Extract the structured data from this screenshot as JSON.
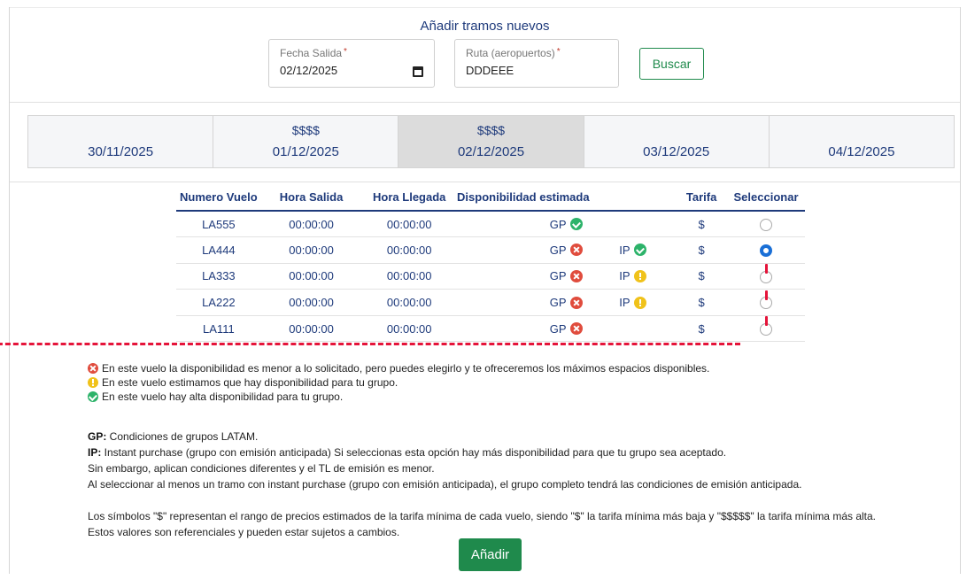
{
  "header": {
    "title": "Añadir tramos nuevos"
  },
  "form": {
    "fecha_label": "Fecha Salida",
    "fecha_value": "02/12/2025",
    "ruta_label": "Ruta (aeropuertos)",
    "ruta_value": "DDDEEE",
    "required_mark": "*",
    "buscar_label": "Buscar"
  },
  "dates": [
    {
      "price": "",
      "date": "30/11/2025",
      "active": false
    },
    {
      "price": "$$$$",
      "date": "01/12/2025",
      "active": false
    },
    {
      "price": "$$$$",
      "date": "02/12/2025",
      "active": true
    },
    {
      "price": "",
      "date": "03/12/2025",
      "active": false
    },
    {
      "price": "",
      "date": "04/12/2025",
      "active": false
    }
  ],
  "table": {
    "headers": [
      "Numero Vuelo",
      "Hora Salida",
      "Hora Llegada",
      "Disponibilidad estimada",
      "",
      "Tarifa",
      "Seleccionar"
    ],
    "rows": [
      {
        "flight": "LA555",
        "dep": "00:00:00",
        "arr": "00:00:00",
        "gp": "GP",
        "gp_status": "green",
        "ip": "",
        "ip_status": "",
        "tarifa": "$",
        "selected": false,
        "marked": false
      },
      {
        "flight": "LA444",
        "dep": "00:00:00",
        "arr": "00:00:00",
        "gp": "GP",
        "gp_status": "red",
        "ip": "IP",
        "ip_status": "green",
        "tarifa": "$",
        "selected": true,
        "marked": false
      },
      {
        "flight": "LA333",
        "dep": "00:00:00",
        "arr": "00:00:00",
        "gp": "GP",
        "gp_status": "red",
        "ip": "IP",
        "ip_status": "yellow",
        "tarifa": "$",
        "selected": false,
        "marked": true
      },
      {
        "flight": "LA222",
        "dep": "00:00:00",
        "arr": "00:00:00",
        "gp": "GP",
        "gp_status": "red",
        "ip": "IP",
        "ip_status": "yellow",
        "tarifa": "$",
        "selected": false,
        "marked": true
      },
      {
        "flight": "LA111",
        "dep": "00:00:00",
        "arr": "00:00:00",
        "gp": "GP",
        "gp_status": "red",
        "ip": "",
        "ip_status": "",
        "tarifa": "$",
        "selected": false,
        "marked": true
      }
    ]
  },
  "legend": {
    "red": "En este vuelo la disponibilidad es menor a lo solicitado, pero puedes elegirlo y te ofreceremos los máximos espacios disponibles.",
    "yellow": "En este vuelo estimamos que hay disponibilidad para tu grupo.",
    "green": "En este vuelo hay alta disponibilidad para tu grupo."
  },
  "notes": {
    "gp_term": "GP:",
    "gp_text": " Condiciones de grupos LATAM.",
    "ip_term": "IP:",
    "ip_text": " Instant purchase (grupo con emisión anticipada) Si seleccionas esta opción hay más disponibilidad para que tu grupo sea aceptado.",
    "line3": "Sin embargo, aplican condiciones diferentes y el TL de emisión es menor.",
    "line4": "Al seleccionar al menos un tramo con instant purchase (grupo con emisión anticipada), el grupo completo tendrá las condiciones de emisión anticipada.",
    "line5": "Los símbolos \"$\" representan el rango de precios estimados de la tarifa mínima de cada vuelo, siendo \"$\" la tarifa mínima más baja y \"$$$$$\" la tarifa mínima más alta.",
    "line6": "Estos valores son referenciales y pueden estar sujetos a cambios."
  },
  "actions": {
    "add_label": "Añadir"
  },
  "colors": {
    "brand_green": "#1f8a4c",
    "navy": "#1e3a7b",
    "status_red": "#e04c3d",
    "status_yellow": "#f0c21a",
    "status_green": "#2db36a",
    "annotation_red": "#e5143a"
  }
}
